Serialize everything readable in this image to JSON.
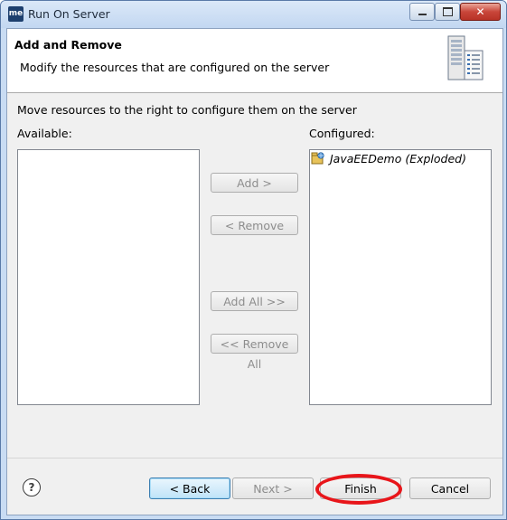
{
  "window": {
    "title": "Run On Server",
    "app_icon_text": "me"
  },
  "banner": {
    "title": "Add and Remove",
    "description": "Modify the resources that are configured on the server",
    "icon": "server-icon"
  },
  "main": {
    "instructions": "Move resources to the right to configure them on the server",
    "available_label": "Available:",
    "configured_label": "Configured:",
    "available_items": [],
    "configured_items": [
      {
        "label": "JavaEEDemo (Exploded)",
        "icon": "web-module-icon"
      }
    ]
  },
  "transfer_buttons": {
    "add": "Add >",
    "remove": "< Remove",
    "add_all": "Add All >>",
    "remove_all": "<< Remove All"
  },
  "footer": {
    "help_icon": "question-icon",
    "back": "< Back",
    "next": "Next >",
    "finish": "Finish",
    "cancel": "Cancel"
  },
  "colors": {
    "highlight": "#e8151a",
    "titlebar": "#c9dcf3",
    "default_button_border": "#3c7fb1"
  }
}
